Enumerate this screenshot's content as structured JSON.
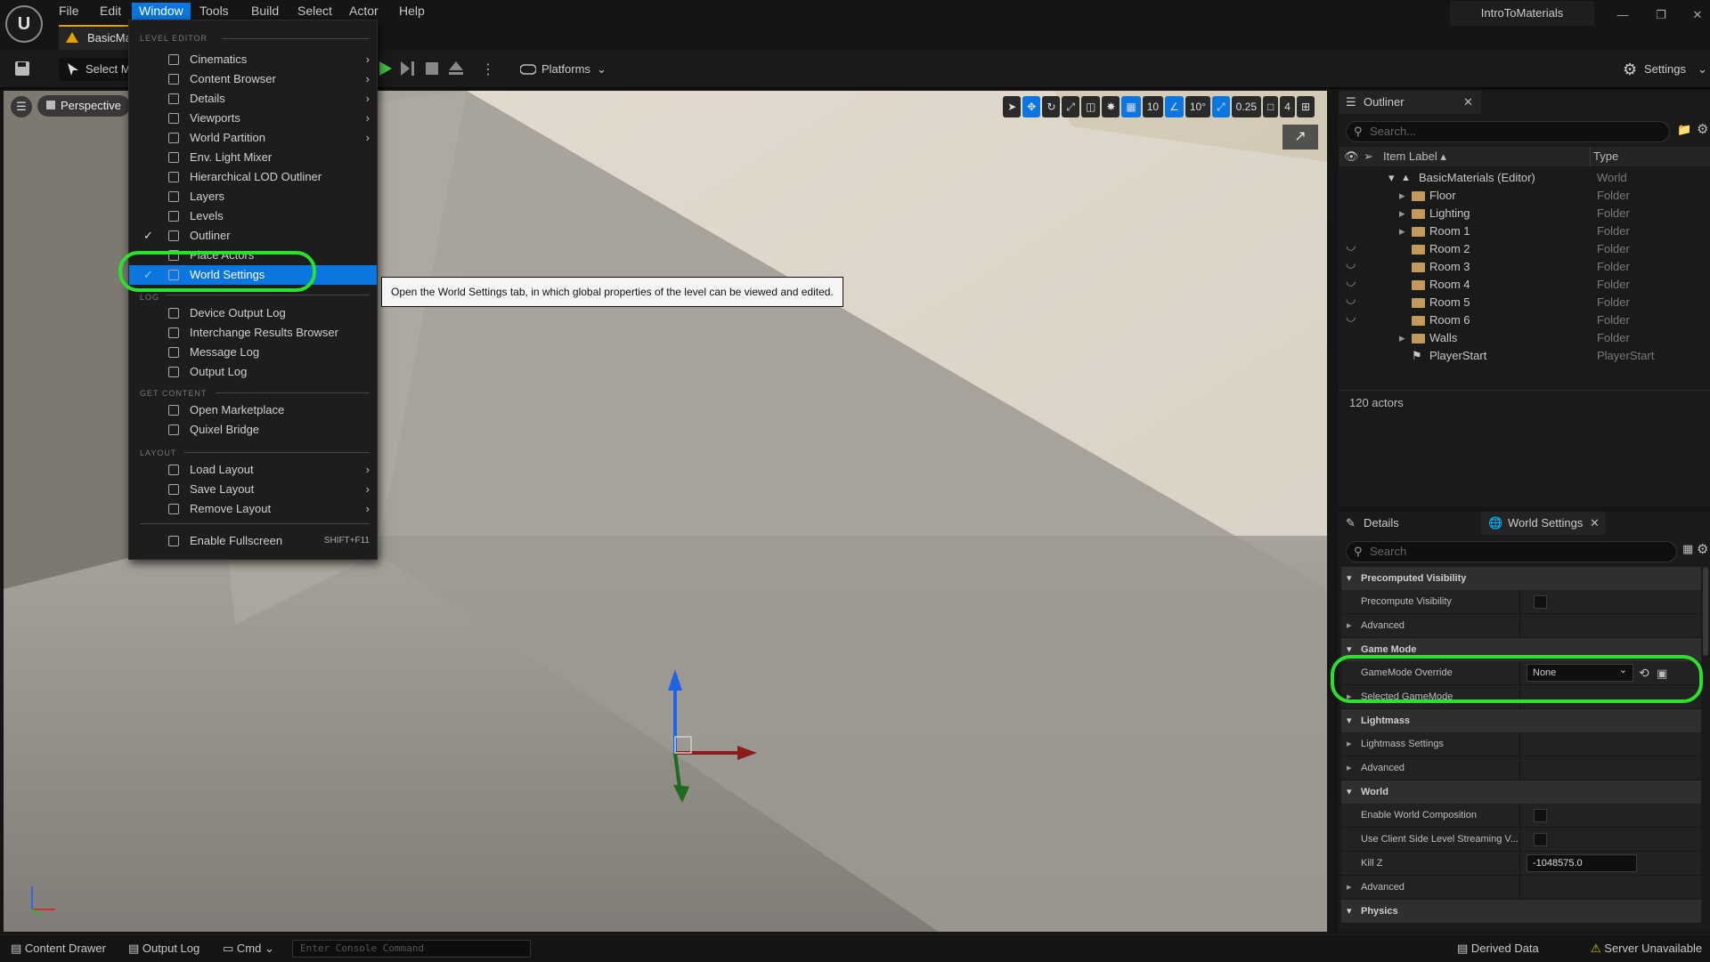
{
  "app": {
    "project_name": "IntroToMaterials",
    "document_tab": "BasicMaterials"
  },
  "menubar": {
    "items": [
      "File",
      "Edit",
      "Window",
      "Tools",
      "Build",
      "Select",
      "Actor",
      "Help"
    ],
    "active": "Window"
  },
  "toolbar": {
    "select_mode": "Select Mode",
    "platforms": "Platforms",
    "settings": "Settings"
  },
  "viewport": {
    "view_mode": "Perspective",
    "grid_snap": "10",
    "rotation_snap": "10°",
    "scale_snap": "0.25",
    "camera_speed": "4"
  },
  "window_menu": {
    "sections": {
      "level_editor": "LEVEL EDITOR",
      "log": "LOG",
      "get_content": "GET CONTENT",
      "layout": "LAYOUT"
    },
    "level_editor_items": [
      {
        "label": "Cinematics",
        "submenu": true,
        "checked": false
      },
      {
        "label": "Content Browser",
        "submenu": true,
        "checked": false
      },
      {
        "label": "Details",
        "submenu": true,
        "checked": false
      },
      {
        "label": "Viewports",
        "submenu": true,
        "checked": false
      },
      {
        "label": "World Partition",
        "submenu": true,
        "checked": false
      },
      {
        "label": "Env. Light Mixer",
        "submenu": false,
        "checked": false
      },
      {
        "label": "Hierarchical LOD Outliner",
        "submenu": false,
        "checked": false
      },
      {
        "label": "Layers",
        "submenu": false,
        "checked": false
      },
      {
        "label": "Levels",
        "submenu": false,
        "checked": false
      },
      {
        "label": "Outliner",
        "submenu": false,
        "checked": true
      },
      {
        "label": "Place Actors",
        "submenu": false,
        "checked": false
      },
      {
        "label": "World Settings",
        "submenu": false,
        "checked": true
      }
    ],
    "log_items": [
      "Device Output Log",
      "Interchange Results Browser",
      "Message Log",
      "Output Log"
    ],
    "get_content_items": [
      "Open Marketplace",
      "Quixel Bridge"
    ],
    "layout_items": [
      "Load Layout",
      "Save Layout",
      "Remove Layout"
    ],
    "fullscreen": {
      "label": "Enable Fullscreen",
      "shortcut": "SHIFT+F11"
    }
  },
  "tooltip": "Open the World Settings tab, in which global properties of the level can be viewed and edited.",
  "outliner": {
    "title": "Outliner",
    "search_placeholder": "Search...",
    "columns": {
      "label": "Item Label",
      "type": "Type"
    },
    "rows": [
      {
        "label": "BasicMaterials (Editor)",
        "type": "World",
        "indent": 0,
        "kind": "world",
        "hidden": false
      },
      {
        "label": "Floor",
        "type": "Folder",
        "indent": 1,
        "kind": "folder",
        "hidden": false
      },
      {
        "label": "Lighting",
        "type": "Folder",
        "indent": 1,
        "kind": "folder",
        "hidden": false
      },
      {
        "label": "Room 1",
        "type": "Folder",
        "indent": 1,
        "kind": "folder",
        "hidden": false
      },
      {
        "label": "Room 2",
        "type": "Folder",
        "indent": 1,
        "kind": "folder",
        "hidden": true
      },
      {
        "label": "Room 3",
        "type": "Folder",
        "indent": 1,
        "kind": "folder",
        "hidden": true
      },
      {
        "label": "Room 4",
        "type": "Folder",
        "indent": 1,
        "kind": "folder",
        "hidden": true
      },
      {
        "label": "Room 5",
        "type": "Folder",
        "indent": 1,
        "kind": "folder",
        "hidden": true
      },
      {
        "label": "Room 6",
        "type": "Folder",
        "indent": 1,
        "kind": "folder",
        "hidden": true
      },
      {
        "label": "Walls",
        "type": "Folder",
        "indent": 1,
        "kind": "folder",
        "hidden": false
      },
      {
        "label": "PlayerStart",
        "type": "PlayerStart",
        "indent": 1,
        "kind": "actor",
        "hidden": false
      }
    ],
    "actor_count": "120 actors"
  },
  "details": {
    "tabs": [
      "Details",
      "World Settings"
    ],
    "search_placeholder": "Search",
    "rows": [
      {
        "kind": "section",
        "label": "Precomputed Visibility"
      },
      {
        "kind": "prop",
        "label": "Precompute Visibility",
        "control": "checkbox"
      },
      {
        "kind": "sub",
        "label": "Advanced"
      },
      {
        "kind": "section",
        "label": "Game Mode"
      },
      {
        "kind": "prop",
        "label": "GameMode Override",
        "control": "dropdown",
        "value": "None"
      },
      {
        "kind": "sub",
        "label": "Selected GameMode"
      },
      {
        "kind": "section",
        "label": "Lightmass"
      },
      {
        "kind": "sub",
        "label": "Lightmass Settings"
      },
      {
        "kind": "sub",
        "label": "Advanced"
      },
      {
        "kind": "section",
        "label": "World"
      },
      {
        "kind": "prop",
        "label": "Enable World Composition",
        "control": "checkbox"
      },
      {
        "kind": "prop",
        "label": "Use Client Side Level Streaming V...",
        "control": "checkbox"
      },
      {
        "kind": "prop",
        "label": "Kill Z",
        "control": "number",
        "value": "-1048575.0"
      },
      {
        "kind": "sub",
        "label": "Advanced"
      },
      {
        "kind": "section",
        "label": "Physics"
      }
    ]
  },
  "statusbar": {
    "content_drawer": "Content Drawer",
    "output_log": "Output Log",
    "cmd": "Cmd",
    "console_placeholder": "Enter Console Command",
    "derived_data": "Derived Data",
    "server": "Server Unavailable"
  },
  "colors": {
    "accent": "#0b76e0",
    "highlight_ring": "#2de02d",
    "folder": "#c39a5a"
  }
}
